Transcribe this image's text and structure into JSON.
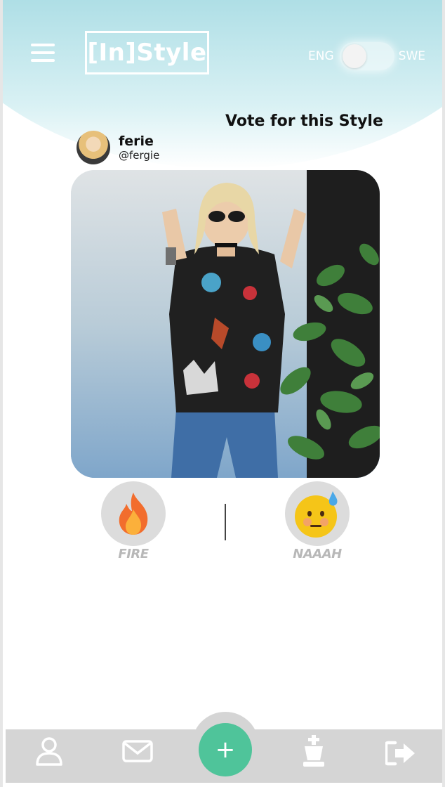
{
  "header": {
    "logo_text": "[In]Style",
    "lang_left": "ENG",
    "lang_right": "SWE",
    "colors": {
      "gradient_top": "#92d0da",
      "gradient_bottom": "#d9f1f4"
    }
  },
  "post": {
    "title": "Vote for this Style",
    "user_name": "ferie",
    "user_handle": "@fergie"
  },
  "votes": {
    "fire_label": "FIRE",
    "naaah_label": "NAAAH"
  },
  "bottom_nav": {
    "add_label": "+",
    "items": [
      "profile-icon",
      "mail-icon",
      "add-button",
      "chess-king-icon",
      "logout-icon"
    ],
    "colors": {
      "bar": "#d5d5d5",
      "fab": "#4fc49a"
    }
  }
}
